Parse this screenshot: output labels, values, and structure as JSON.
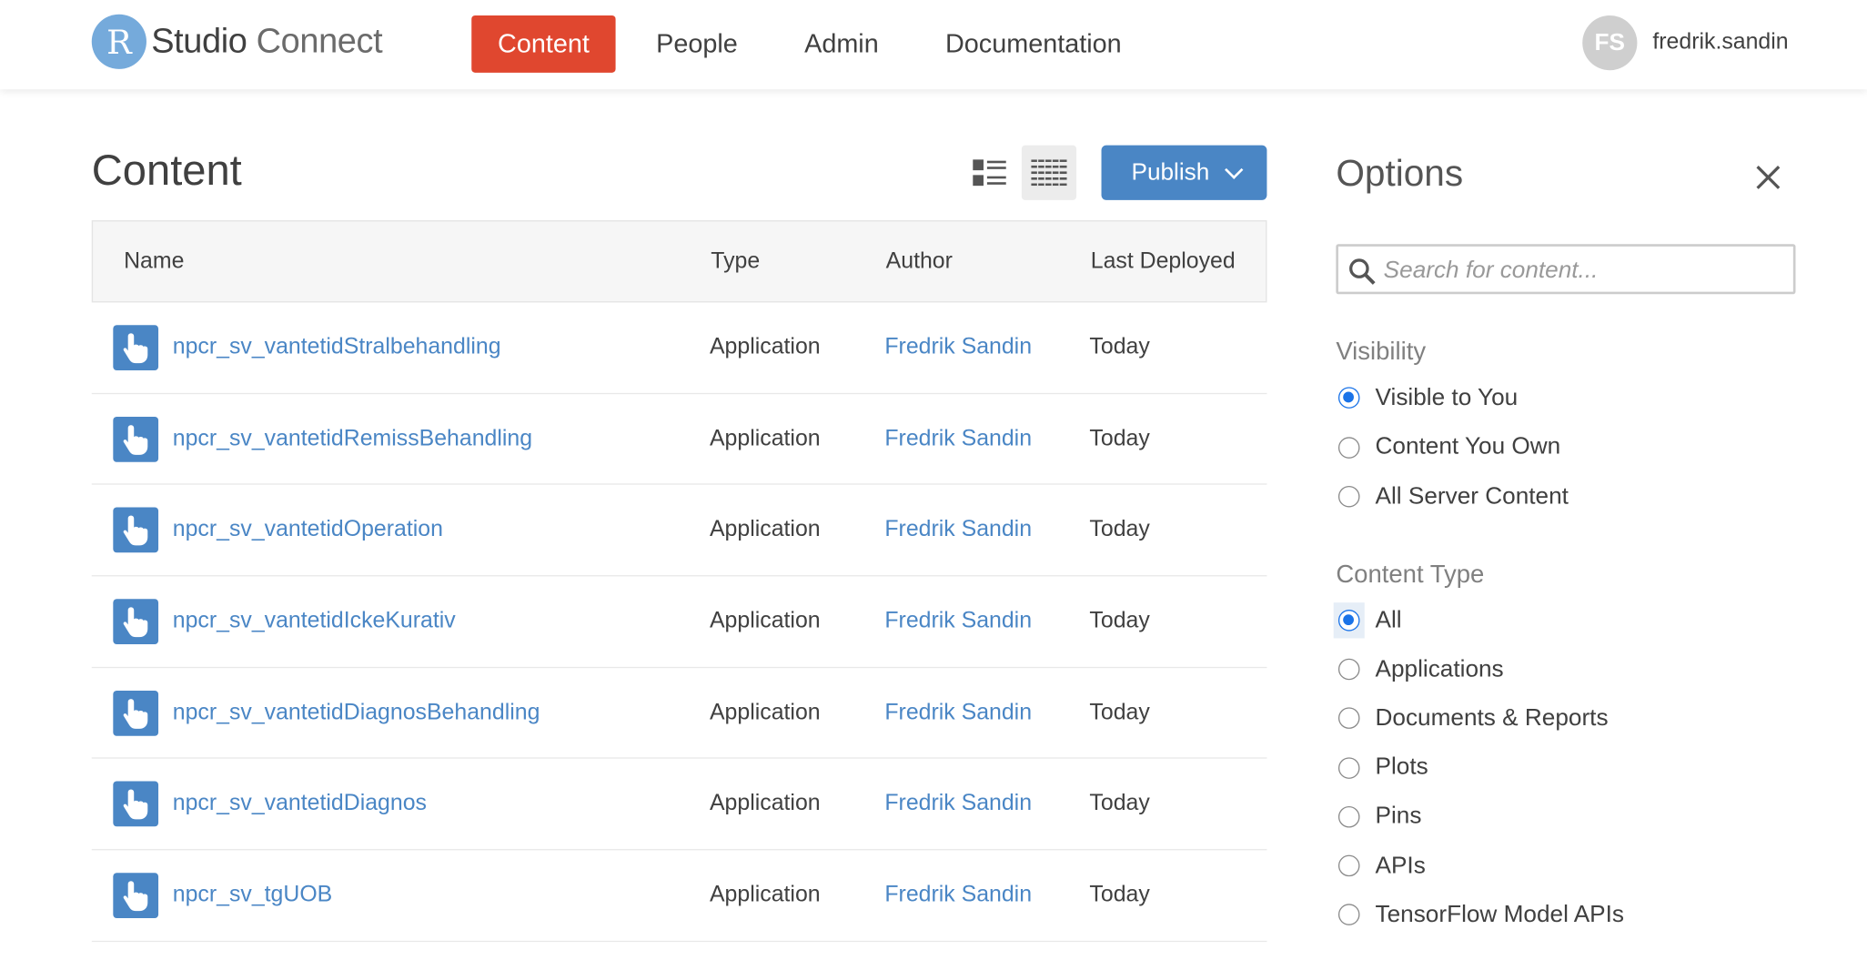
{
  "header": {
    "logo_letter": "R",
    "logo_word1": "Studio",
    "logo_word2": "Connect",
    "nav": [
      "Content",
      "People",
      "Admin",
      "Documentation"
    ],
    "active_nav": "Content",
    "user_initials": "FS",
    "username": "fredrik.sandin"
  },
  "main": {
    "title": "Content",
    "publish_label": "Publish",
    "columns": [
      "Name",
      "Type",
      "Author",
      "Last Deployed"
    ],
    "rows": [
      {
        "name": "npcr_sv_vantetidStralbehandling",
        "type": "Application",
        "author": "Fredrik Sandin",
        "deployed": "Today"
      },
      {
        "name": "npcr_sv_vantetidRemissBehandling",
        "type": "Application",
        "author": "Fredrik Sandin",
        "deployed": "Today"
      },
      {
        "name": "npcr_sv_vantetidOperation",
        "type": "Application",
        "author": "Fredrik Sandin",
        "deployed": "Today"
      },
      {
        "name": "npcr_sv_vantetidIckeKurativ",
        "type": "Application",
        "author": "Fredrik Sandin",
        "deployed": "Today"
      },
      {
        "name": "npcr_sv_vantetidDiagnosBehandling",
        "type": "Application",
        "author": "Fredrik Sandin",
        "deployed": "Today"
      },
      {
        "name": "npcr_sv_vantetidDiagnos",
        "type": "Application",
        "author": "Fredrik Sandin",
        "deployed": "Today"
      },
      {
        "name": "npcr_sv_tgUOB",
        "type": "Application",
        "author": "Fredrik Sandin",
        "deployed": "Today"
      }
    ]
  },
  "options": {
    "title": "Options",
    "search_placeholder": "Search for content...",
    "visibility_label": "Visibility",
    "visibility": [
      {
        "label": "Visible to You",
        "checked": true
      },
      {
        "label": "Content You Own",
        "checked": false
      },
      {
        "label": "All Server Content",
        "checked": false
      }
    ],
    "content_type_label": "Content Type",
    "content_types": [
      {
        "label": "All",
        "checked": true
      },
      {
        "label": "Applications",
        "checked": false
      },
      {
        "label": "Documents & Reports",
        "checked": false
      },
      {
        "label": "Plots",
        "checked": false
      },
      {
        "label": "Pins",
        "checked": false
      },
      {
        "label": "APIs",
        "checked": false
      },
      {
        "label": "TensorFlow Model APIs",
        "checked": false
      }
    ]
  },
  "colors": {
    "accent_nav": "#e0472f",
    "link": "#4a86c5",
    "radio_checked": "#1a73e8"
  }
}
